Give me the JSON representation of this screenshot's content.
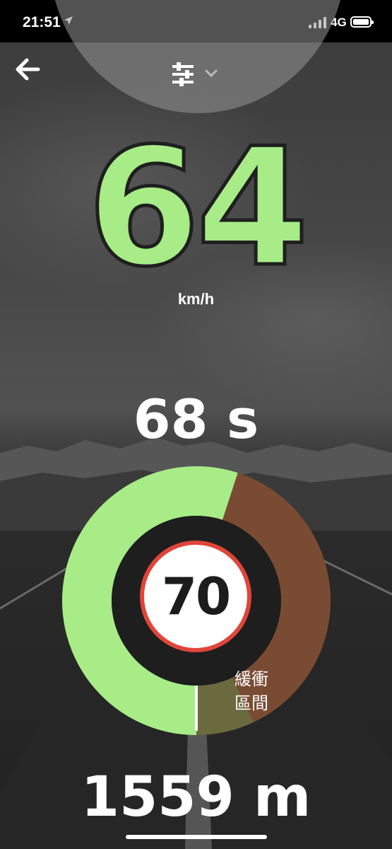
{
  "status_bar": {
    "time": "21:51",
    "network": "4G",
    "location_icon": "location-arrow-icon",
    "signal_icon": "signal-bars-icon",
    "battery_icon": "battery-icon"
  },
  "header": {
    "back_icon": "back-arrow-icon",
    "settings_icon": "sliders-icon",
    "dropdown_icon": "chevron-down-icon"
  },
  "speed": {
    "value": "64",
    "unit": "km/h",
    "color": "#a7ec87"
  },
  "countdown": {
    "value": "68 s"
  },
  "gauge": {
    "progress_fraction": 0.55,
    "buffer_fraction": 0.07,
    "colors": {
      "progress": "#a7ec87",
      "remaining": "#7a4b33",
      "buffer": "#6b6a3e",
      "marker": "#ffffff"
    }
  },
  "speed_limit": {
    "value": "70",
    "ring_color": "#e0453a"
  },
  "buffer_zone": {
    "line1": "緩衝",
    "line2": "區間"
  },
  "distance": {
    "value": "1559 m"
  }
}
